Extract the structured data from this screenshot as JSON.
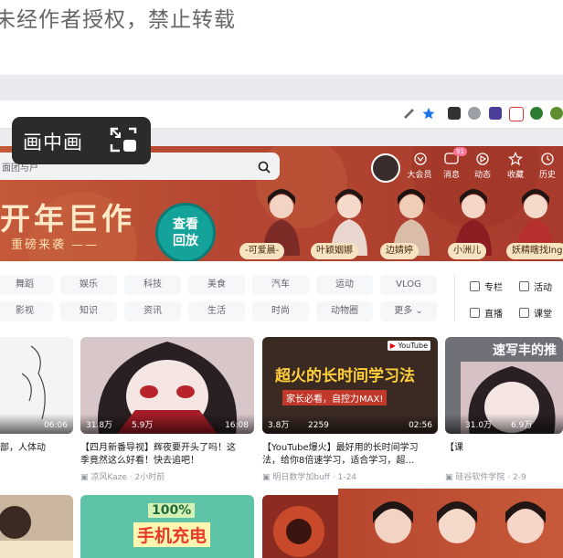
{
  "watermark": "未经作者授权，禁止转载",
  "pip": {
    "label": "画中画"
  },
  "header": {
    "search_placeholder": "面团与户",
    "nav": [
      {
        "label": "大会员",
        "icon": "vip-icon"
      },
      {
        "label": "消息",
        "icon": "message-icon",
        "badge": "91"
      },
      {
        "label": "动态",
        "icon": "dynamic-icon"
      },
      {
        "label": "收藏",
        "icon": "favorite-icon"
      },
      {
        "label": "历史",
        "icon": "history-icon"
      }
    ]
  },
  "banner": {
    "headline": "开年巨作",
    "subline": "重磅来袭 ——",
    "cta_line1": "查看",
    "cta_line2": "回放",
    "characters": [
      "-可爱晨-",
      "叶颖姻娜",
      "边婧婷",
      "小洲儿",
      "妖精瞎找lng"
    ]
  },
  "categories": {
    "row1": [
      "舞蹈",
      "娱乐",
      "科技",
      "美食",
      "汽车",
      "运动",
      "VLOG"
    ],
    "row2": [
      "影视",
      "知识",
      "资讯",
      "生活",
      "时尚",
      "动物圈",
      "更多"
    ],
    "side": [
      {
        "label": "专栏"
      },
      {
        "label": "活动"
      },
      {
        "label": "直播"
      },
      {
        "label": "课堂"
      }
    ]
  },
  "videos": [
    {
      "title_l1": "部，人体动",
      "title_l2": "",
      "duration": "06:06",
      "views": "",
      "likes": "",
      "author": "",
      "time": ""
    },
    {
      "title_l1": "【四月新番导视】辉夜要开头了吗！这",
      "title_l2": "季竟然这么好看！快去追吧！",
      "duration": "16:08",
      "views": "31.8万",
      "likes": "5.9万",
      "author": "凉风Kaze",
      "time": "2小时前"
    },
    {
      "title_l1": "【YouTube爆火】最好用的长时间学习",
      "title_l2": "法，给你8倍速学习，适合学习，超…",
      "duration": "02:56",
      "views": "3.8万",
      "likes": "2259",
      "author": "明日数学加buff",
      "time": "1-24"
    },
    {
      "title_l1": "【课",
      "title_l2": "",
      "duration": "",
      "views": "31.0万",
      "likes": "6.9万",
      "author": "硅谷软件学院",
      "time": "2-9"
    }
  ],
  "thumb_text": {
    "youtube_headline": "超火的长时间学习法",
    "youtube_sub": "家长必看，自控力MAX!",
    "charge_pct": "100%",
    "charge_label": "手机充电",
    "right_partial": "速写丰的推"
  },
  "colors": {
    "brand_pink": "#fb7299",
    "banner_red": "#b54632",
    "cta_teal": "#14a39a"
  }
}
